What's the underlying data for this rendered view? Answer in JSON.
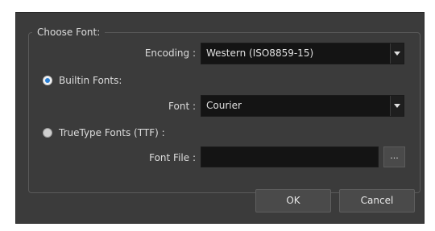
{
  "dialog": {
    "group_title": "Choose Font:",
    "encoding": {
      "label": "Encoding :",
      "value": "Western (ISO8859-15)"
    },
    "builtin": {
      "label": "Builtin Fonts:",
      "checked": true,
      "font_label": "Font :",
      "font_value": "Courier"
    },
    "truetype": {
      "label": "TrueType Fonts (TTF) :",
      "checked": false,
      "file_label": "Font File :",
      "file_value": "",
      "browse_label": "..."
    },
    "buttons": {
      "ok": "OK",
      "cancel": "Cancel"
    }
  },
  "icons": {
    "combo_arrow": "chevron-down-icon",
    "radio_selected": "radio-selected-icon",
    "radio_unselected": "radio-unselected-icon"
  },
  "colors": {
    "dialog_bg": "#3b3b3b",
    "field_bg": "#141414",
    "button_bg": "#4a4a4a",
    "text": "#dcdcdc",
    "radio_accent": "#2a7fd4"
  }
}
